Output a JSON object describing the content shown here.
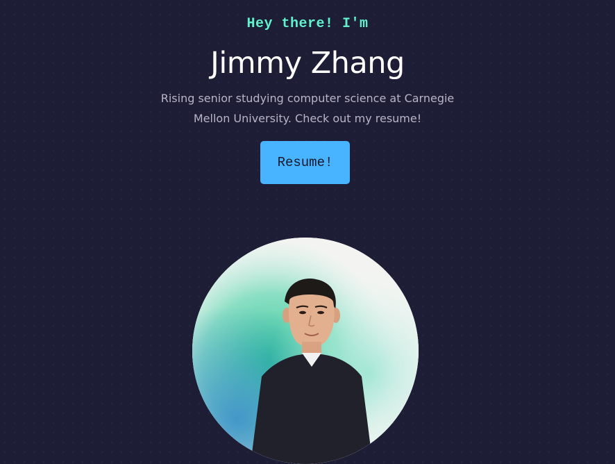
{
  "hero": {
    "greeting": "Hey there! I'm",
    "name": "Jimmy Zhang",
    "tagline": "Rising senior studying computer science at Carnegie Mellon University. Check out my resume!",
    "resume_label": "Resume!"
  },
  "portrait": {
    "alt": "Portrait photo of Jimmy Zhang on a watercolor background"
  },
  "colors": {
    "background": "#1e1d36",
    "greeting": "#5ff2cc",
    "name": "#ffffff",
    "tagline": "#b6b6c6",
    "button": "#48b3ff",
    "button_text": "#16182a"
  }
}
